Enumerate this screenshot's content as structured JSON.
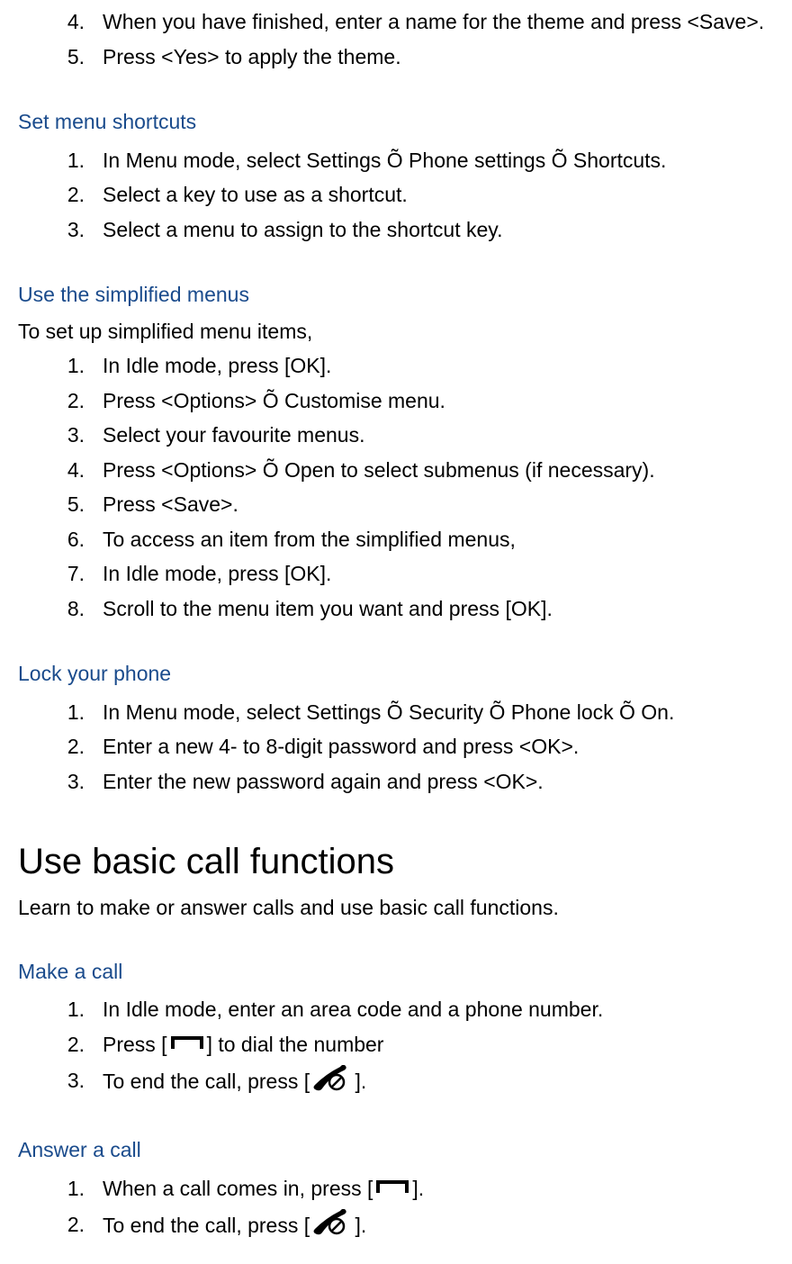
{
  "sections": {
    "theme_continue": {
      "items": [
        {
          "num": "4.",
          "text": "When you have finished, enter a name for the theme and press <Save>."
        },
        {
          "num": "5.",
          "text": "Press <Yes> to apply the theme."
        }
      ]
    },
    "set_menu_shortcuts": {
      "heading": "Set menu shortcuts",
      "items": [
        {
          "num": "1.",
          "text": "In Menu mode, select Settings Õ Phone settings Õ Shortcuts."
        },
        {
          "num": "2.",
          "text": "Select a key to use as a shortcut."
        },
        {
          "num": "3.",
          "text": "Select a menu to assign to the shortcut key."
        }
      ]
    },
    "simplified_menus": {
      "heading": "Use the simplified menus",
      "subtext": "To set up simplified menu items,",
      "items": [
        {
          "num": "1.",
          "text": "In Idle mode, press [OK]."
        },
        {
          "num": "2.",
          "text": "Press <Options> Õ Customise menu."
        },
        {
          "num": "3.",
          "text": "Select your favourite menus."
        },
        {
          "num": "4.",
          "text": "Press <Options> Õ Open to select submenus (if necessary)."
        },
        {
          "num": "5.",
          "text": "Press <Save>."
        },
        {
          "num": "6.",
          "text": "To access an item from the simplified menus,"
        },
        {
          "num": "7.",
          "text": "In Idle mode, press [OK]."
        },
        {
          "num": "8.",
          "text": "Scroll to the menu item you want and press [OK]."
        }
      ]
    },
    "lock_phone": {
      "heading": "Lock your phone",
      "items": [
        {
          "num": "1.",
          "text": "In Menu mode, select Settings Õ Security Õ Phone lock Õ On."
        },
        {
          "num": "2.",
          "text": "Enter a new 4- to 8-digit password and press <OK>."
        },
        {
          "num": "3.",
          "text": "Enter the new password again and press <OK>."
        }
      ]
    },
    "basic_call": {
      "heading": "Use basic call functions",
      "intro": "Learn to make or answer calls and use basic call functions."
    },
    "make_call": {
      "heading": "Make a call",
      "items": [
        {
          "num": "1.",
          "text": "In Idle mode, enter an area code and a phone number."
        },
        {
          "num": "2.",
          "text_before": "Press [",
          "icon": "call",
          "text_after": "] to dial the number"
        },
        {
          "num": "3.",
          "text_before": "To end the call, press [",
          "icon": "end",
          "text_after": " ]."
        }
      ]
    },
    "answer_call": {
      "heading": "Answer a call",
      "items": [
        {
          "num": "1.",
          "text_before": "When a call comes in, press [",
          "icon": "call",
          "text_after": "]."
        },
        {
          "num": "2.",
          "text_before": "To end the call, press [",
          "icon": "end",
          "text_after": " ]."
        }
      ]
    }
  }
}
